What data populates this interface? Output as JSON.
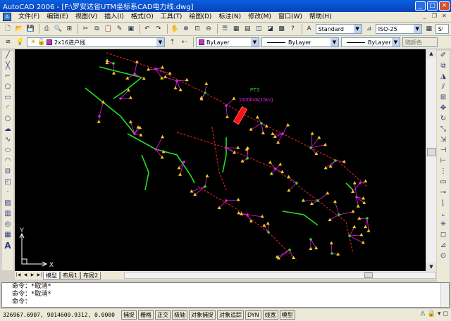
{
  "title": "AutoCAD 2006 - [F:\\罗安达省UTM坐标系CAD电力线.dwg]",
  "menu": [
    "文件(F)",
    "编辑(E)",
    "视图(V)",
    "插入(I)",
    "格式(O)",
    "工具(T)",
    "绘图(D)",
    "标注(N)",
    "修改(M)",
    "窗口(W)",
    "帮助(H)"
  ],
  "toolbar": {
    "text_style": "Standard",
    "dim_style": "ISO-25",
    "table_style": "Standard"
  },
  "properties": {
    "layer": "2x16进户线",
    "color": "ByLayer",
    "linetype": "ByLayer",
    "lineweight": "ByLayer",
    "plotstyle": "随颜色"
  },
  "drawing": {
    "label_name": "PT3",
    "label_spec": "1600kVA(15kV)",
    "axis_x": "X",
    "axis_y": "Y",
    "colors": {
      "red_line": "#d02020",
      "green_line": "#22e022",
      "magenta": "#e020e0",
      "yellow": "#f0d020",
      "green_label": "#22dd22"
    }
  },
  "tabs": [
    "模型",
    "布局1",
    "布局2"
  ],
  "command_lines": [
    "命令：*取消*",
    "命令：*取消*",
    "命令："
  ],
  "status": {
    "coords": "326967.6907, 9014600.9312, 0.0000",
    "buttons": [
      "捕捉",
      "栅格",
      "正交",
      "极轴",
      "对象捕捉",
      "对象追踪",
      "DYN",
      "线宽",
      "模型"
    ]
  }
}
